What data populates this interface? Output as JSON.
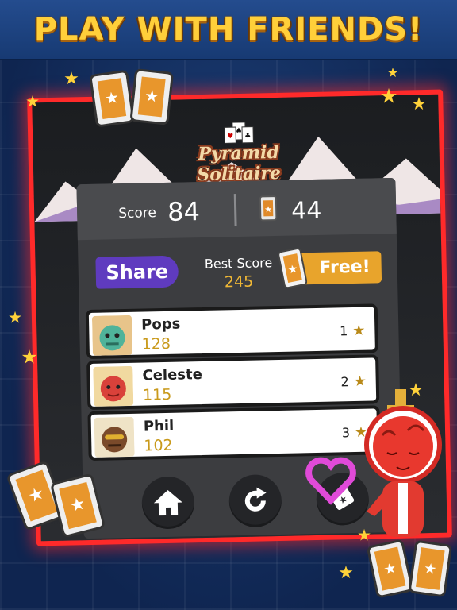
{
  "banner": {
    "title": "PLAY WITH FRIENDS!"
  },
  "logo": {
    "line1": "Pyramid",
    "line2": "Solitaire"
  },
  "score": {
    "label": "Score",
    "value": "84",
    "tickets": "44"
  },
  "actions": {
    "share_label": "Share",
    "free_label": "Free!"
  },
  "best": {
    "label": "Best Score",
    "value": "245"
  },
  "leaderboard": [
    {
      "name": "Pops",
      "score": "128",
      "rank": "1"
    },
    {
      "name": "Celeste",
      "score": "115",
      "rank": "2"
    },
    {
      "name": "Phil",
      "score": "102",
      "rank": "3"
    }
  ],
  "buttons": {
    "home": "home-icon",
    "replay": "replay-icon",
    "tickets": "ticket-icon"
  },
  "colors": {
    "accent_gold": "#ffcf3a",
    "frame_red": "#ff2a2a",
    "share_purple": "#5f3bbf",
    "free_orange": "#e8a42c",
    "score_gold": "#c99a1c"
  }
}
